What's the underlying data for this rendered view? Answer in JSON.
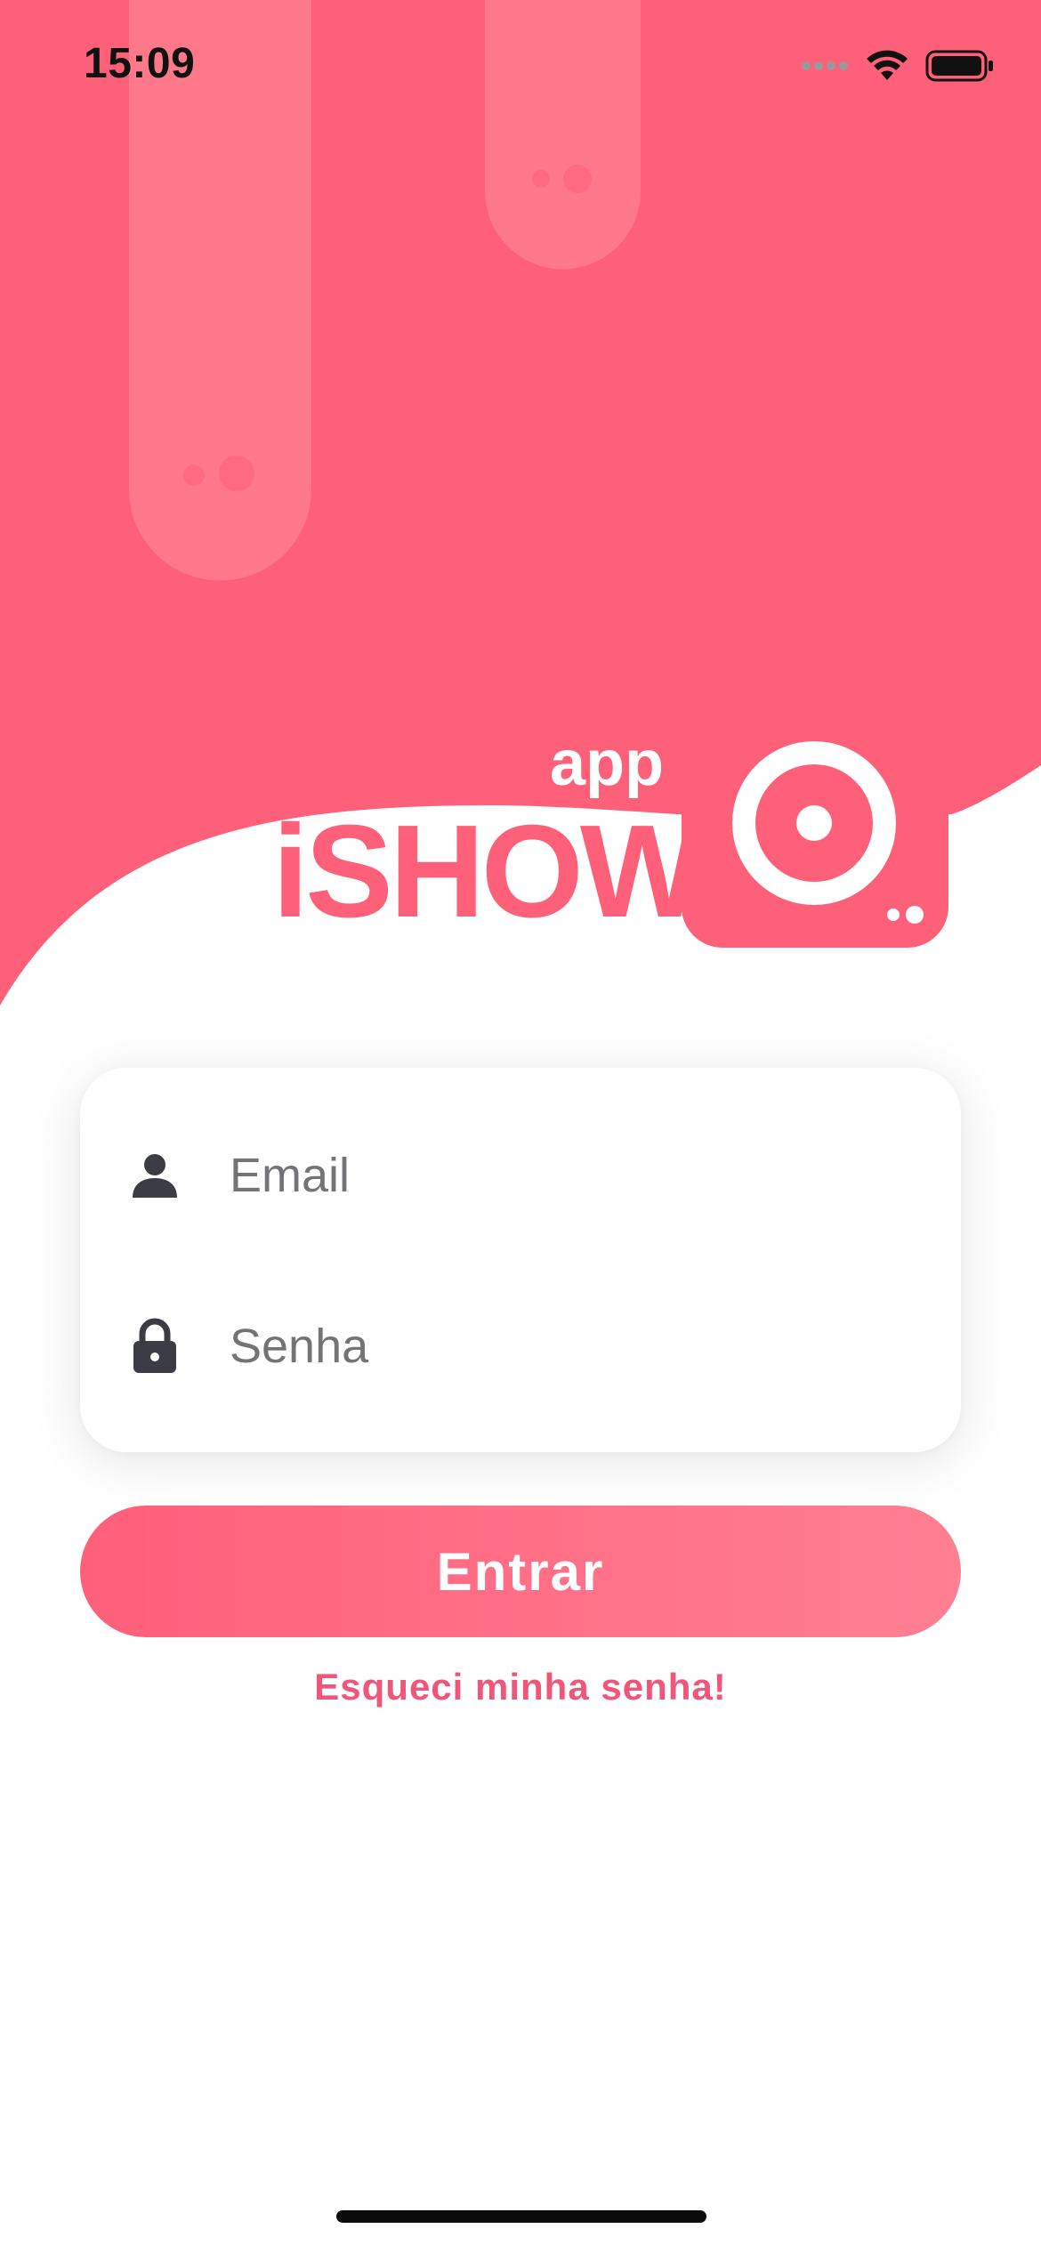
{
  "status_bar": {
    "time": "15:09",
    "icons": [
      "signal-dots-icon",
      "wifi-icon",
      "battery-icon"
    ]
  },
  "brand": {
    "logo_word": "iSHOW",
    "logo_prefix": "app",
    "primary_color": "#ff5f7a",
    "accent_color": "#f0557a"
  },
  "login": {
    "email": {
      "icon": "person-icon",
      "placeholder": "Email",
      "value": ""
    },
    "password": {
      "icon": "lock-icon",
      "placeholder": "Senha",
      "value": ""
    },
    "submit_label": "Entrar",
    "forgot_label": "Esqueci minha senha!"
  }
}
